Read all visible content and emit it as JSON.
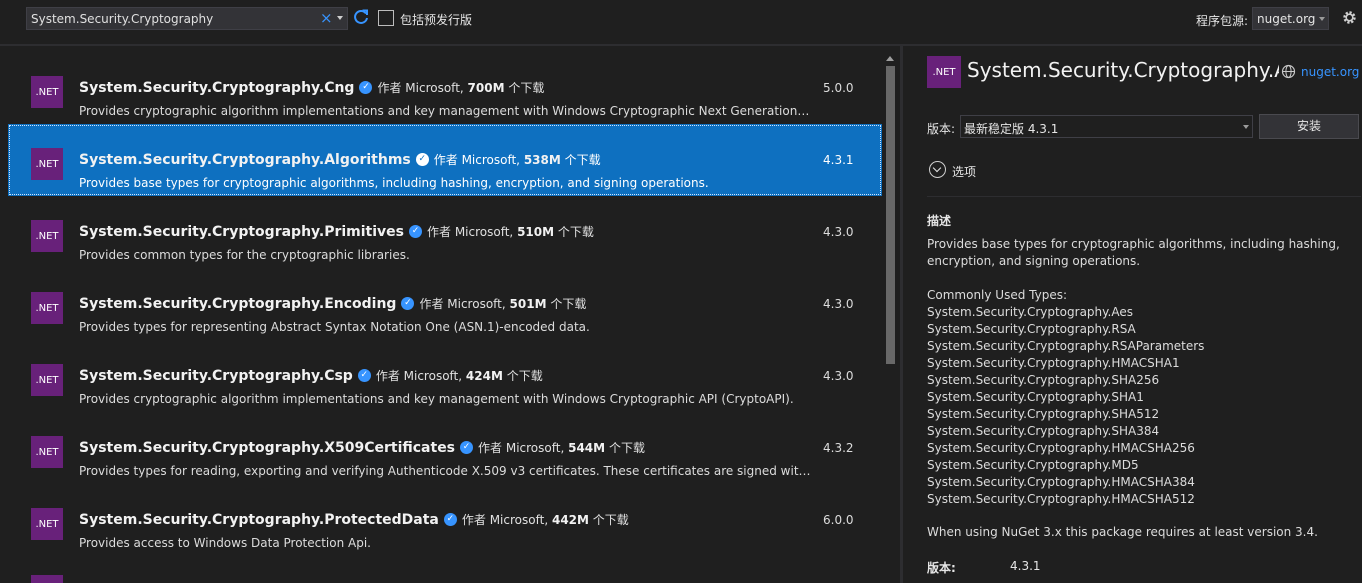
{
  "toolbar": {
    "search_value": "System.Security.Cryptography",
    "prerelease_label": "包括预发行版",
    "source_label": "程序包源:",
    "source_value": "nuget.org"
  },
  "packages": [
    {
      "name": "System.Security.Cryptography.Cng",
      "author_prefix": "作者 Microsoft,",
      "downloads": "700M",
      "downloads_suffix": "个下载",
      "description": "Provides cryptographic algorithm implementations and key management with Windows Cryptographic Next Generation API (CNG).",
      "version": "5.0.0",
      "icon": ".NET"
    },
    {
      "name": "System.Security.Cryptography.Algorithms",
      "author_prefix": "作者 Microsoft,",
      "downloads": "538M",
      "downloads_suffix": "个下载",
      "description": "Provides base types for cryptographic algorithms, including hashing, encryption, and signing operations.",
      "version": "4.3.1",
      "icon": ".NET",
      "selected": true
    },
    {
      "name": "System.Security.Cryptography.Primitives",
      "author_prefix": "作者 Microsoft,",
      "downloads": "510M",
      "downloads_suffix": "个下载",
      "description": "Provides common types for the cryptographic libraries.",
      "version": "4.3.0",
      "icon": ".NET"
    },
    {
      "name": "System.Security.Cryptography.Encoding",
      "author_prefix": "作者 Microsoft,",
      "downloads": "501M",
      "downloads_suffix": "个下载",
      "description": "Provides types for representing Abstract Syntax Notation One (ASN.1)-encoded data.",
      "version": "4.3.0",
      "icon": ".NET"
    },
    {
      "name": "System.Security.Cryptography.Csp",
      "author_prefix": "作者 Microsoft,",
      "downloads": "424M",
      "downloads_suffix": "个下载",
      "description": "Provides cryptographic algorithm implementations and key management with Windows Cryptographic API (CryptoAPI).",
      "version": "4.3.0",
      "icon": ".NET"
    },
    {
      "name": "System.Security.Cryptography.X509Certificates",
      "author_prefix": "作者 Microsoft,",
      "downloads": "544M",
      "downloads_suffix": "个下载",
      "description": "Provides types for reading, exporting and verifying Authenticode X.509 v3 certificates. These certificates are signed with a p…",
      "version": "4.3.2",
      "icon": ".NET"
    },
    {
      "name": "System.Security.Cryptography.ProtectedData",
      "author_prefix": "作者 Microsoft,",
      "downloads": "442M",
      "downloads_suffix": "个下载",
      "description": "Provides access to Windows Data Protection Api.",
      "version": "6.0.0",
      "icon": ".NET"
    }
  ],
  "detail": {
    "icon": ".NET",
    "title": "System.Security.Cryptography.Algorithms",
    "link": "nuget.org",
    "version_label": "版本:",
    "version_value": "最新稳定版 4.3.1",
    "install_label": "安装",
    "options_label": "选项",
    "description_heading": "描述",
    "description": "Provides base types for cryptographic algorithms, including hashing, encryption, and signing operations.",
    "types_heading": "Commonly Used Types:",
    "types": [
      "System.Security.Cryptography.Aes",
      "System.Security.Cryptography.RSA",
      "System.Security.Cryptography.RSAParameters",
      "System.Security.Cryptography.HMACSHA1",
      "System.Security.Cryptography.SHA256",
      "System.Security.Cryptography.SHA1",
      "System.Security.Cryptography.SHA512",
      "System.Security.Cryptography.SHA384",
      "System.Security.Cryptography.HMACSHA256",
      "System.Security.Cryptography.MD5",
      "System.Security.Cryptography.HMACSHA384",
      "System.Security.Cryptography.HMACSHA512"
    ],
    "note": "When using NuGet 3.x this package requires at least version 3.4.",
    "footer_label": "版本:",
    "footer_value": "4.3.1"
  },
  "colors": {
    "accent": "#3794ff",
    "selection": "#0e70c0",
    "net_icon": "#68217a",
    "background": "#1f1f1f"
  }
}
